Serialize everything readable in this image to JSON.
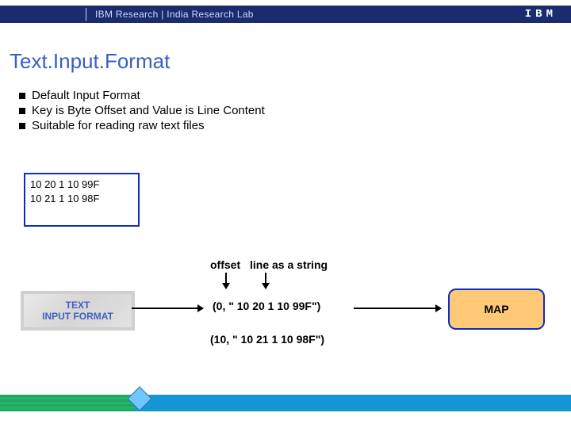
{
  "header": {
    "text": "IBM Research  |  India Research Lab",
    "logo": "IBM"
  },
  "title": "Text.Input.Format",
  "bullets": [
    "Default Input Format",
    "Key is Byte Offset    and     Value is Line Content",
    "Suitable for reading raw text files"
  ],
  "raw": {
    "line1": "10 20 1 10 99F",
    "line2": "10 21 1 10 98F"
  },
  "labels": {
    "offset": "offset",
    "line": "line as a string"
  },
  "boxes": {
    "tif": "TEXT\nINPUT FORMAT",
    "map": "MAP"
  },
  "tuples": {
    "t1": "(0, \" 10 20 1 10 99F\")",
    "t2": "(10, \" 10 21 1 10 98F\")"
  }
}
